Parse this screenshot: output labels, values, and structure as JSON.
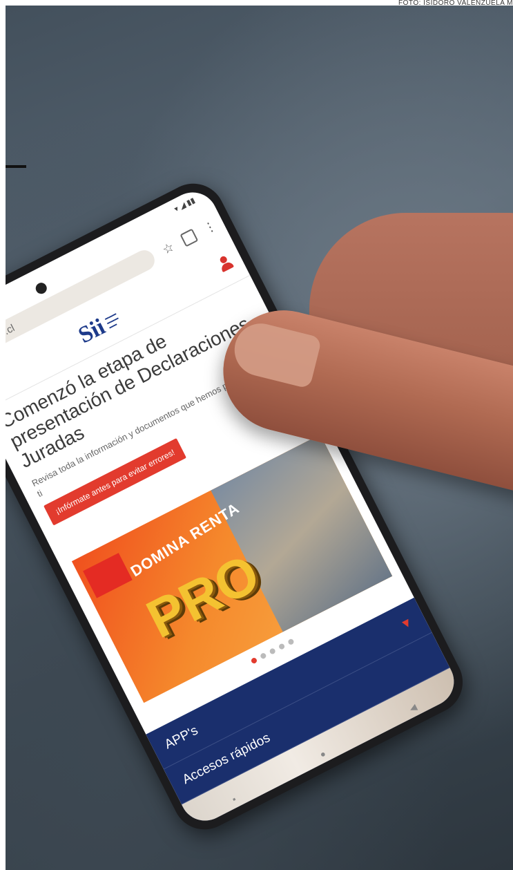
{
  "photo_credit": "FOTO: ISIDORO VALENZUELA M",
  "phone": {
    "url": "homer.sii.cl",
    "site_logo": "Sii",
    "hero": {
      "title": "Comenzó la etapa de presentación de Declaraciones Juradas",
      "body": "Revisa toda la información y documentos que hemos preparado para ti",
      "cta_label": "¡Infórmate antes para evitar errores!"
    },
    "banner": {
      "headline": "DOMINA RENTA",
      "word": "PRO"
    },
    "carousel_dots": 5,
    "carousel_active_index": 0,
    "nav_items": [
      {
        "label": "APP's"
      },
      {
        "label": "Accesos rápidos"
      }
    ]
  },
  "colors": {
    "sii_red": "#e23b2e",
    "sii_blue": "#1a2f6d"
  },
  "icons": [
    "menu-icon",
    "user-icon",
    "star-icon",
    "tabs-icon",
    "more-icon",
    "chevron-down-icon"
  ]
}
